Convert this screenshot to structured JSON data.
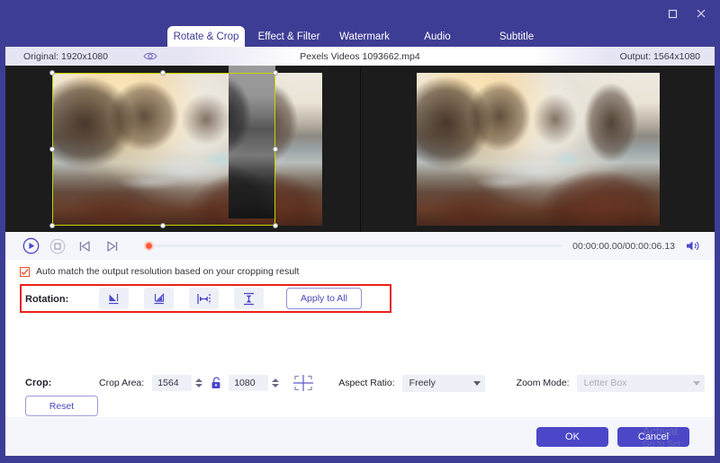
{
  "window": {
    "maximize_icon": "maximize-icon",
    "close_icon": "close-icon"
  },
  "tabs": [
    {
      "label": "Rotate & Crop",
      "active": true
    },
    {
      "label": "Effect & Filter",
      "active": false
    },
    {
      "label": "Watermark",
      "active": false
    },
    {
      "label": "Audio",
      "active": false
    },
    {
      "label": "Subtitle",
      "active": false
    }
  ],
  "info_bar": {
    "original_label": "Original: 1920x1080",
    "eye_icon": "eye-icon",
    "file_name": "Pexels Videos 1093662.mp4",
    "output_label": "Output: 1564x1080"
  },
  "player": {
    "play_icon": "play-icon",
    "stop_icon": "stop-icon",
    "prev_frame_icon": "previous-frame-icon",
    "next_frame_icon": "next-frame-icon",
    "time": "00:00:00.00/00:00:06.13",
    "volume_icon": "volume-icon"
  },
  "options": {
    "auto_match_label": "Auto match the output resolution based on your cropping result",
    "auto_match_checked": true
  },
  "rotation": {
    "label": "Rotation:",
    "buttons": [
      {
        "name": "rotate-left-icon",
        "title": "Rotate Left"
      },
      {
        "name": "rotate-right-icon",
        "title": "Rotate Right"
      },
      {
        "name": "flip-horizontal-icon",
        "title": "Flip Horizontal"
      },
      {
        "name": "flip-vertical-icon",
        "title": "Flip Vertical"
      }
    ],
    "apply_to_all": "Apply to All"
  },
  "crop": {
    "label": "Crop:",
    "crop_area_label": "Crop Area:",
    "width": "1564",
    "height": "1080",
    "lock_icon": "lock-icon",
    "center-crosshair_icon": "crosshair-icon",
    "aspect_ratio_label": "Aspect Ratio:",
    "aspect_ratio_value": "Freely",
    "zoom_mode_label": "Zoom Mode:",
    "zoom_mode_value": "Letter Box",
    "zoom_mode_disabled": true,
    "reset_label": "Reset"
  },
  "footer": {
    "ok_label": "OK",
    "cancel_label": "Cancel"
  },
  "watermark": {
    "line1": "Activat",
    "line2": "Go to Set"
  },
  "colors": {
    "brand_purple": "#3e3d95",
    "button_purple": "#4b47c8",
    "highlight_red": "#e8231a",
    "crop_outline": "#c8d400",
    "seek_head": "#ff5a3c",
    "panel_bg": "#ffffff",
    "bar_bg": "#f4f6fb"
  }
}
